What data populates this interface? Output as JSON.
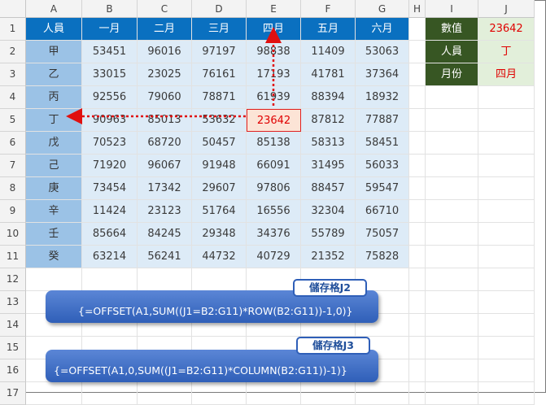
{
  "columns": [
    "A",
    "B",
    "C",
    "D",
    "E",
    "F",
    "G",
    "H",
    "I",
    "J"
  ],
  "rows": [
    "1",
    "2",
    "3",
    "4",
    "5",
    "6",
    "7",
    "8",
    "9",
    "10",
    "11",
    "12",
    "13",
    "14",
    "15",
    "16",
    "17"
  ],
  "table_header": [
    "人員",
    "一月",
    "二月",
    "三月",
    "四月",
    "五月",
    "六月"
  ],
  "table_rows": [
    {
      "name": "甲",
      "values": [
        "53451",
        "96016",
        "97197",
        "98838",
        "11409",
        "53063"
      ]
    },
    {
      "name": "乙",
      "values": [
        "33015",
        "23025",
        "76161",
        "17193",
        "41781",
        "37364"
      ]
    },
    {
      "name": "丙",
      "values": [
        "92556",
        "79060",
        "78871",
        "61939",
        "88394",
        "18932"
      ]
    },
    {
      "name": "丁",
      "values": [
        "90963",
        "85013",
        "53632",
        "23642",
        "87812",
        "77887"
      ]
    },
    {
      "name": "戊",
      "values": [
        "70523",
        "68720",
        "50457",
        "85138",
        "58313",
        "58451"
      ]
    },
    {
      "name": "己",
      "values": [
        "71920",
        "96067",
        "91948",
        "66091",
        "31495",
        "56033"
      ]
    },
    {
      "name": "庚",
      "values": [
        "73454",
        "17342",
        "29607",
        "97806",
        "88457",
        "59547"
      ]
    },
    {
      "name": "辛",
      "values": [
        "11424",
        "23123",
        "51764",
        "16556",
        "32304",
        "66710"
      ]
    },
    {
      "name": "壬",
      "values": [
        "85664",
        "84245",
        "29348",
        "34376",
        "55789",
        "75057"
      ]
    },
    {
      "name": "癸",
      "values": [
        "63214",
        "56241",
        "44732",
        "40729",
        "21352",
        "75828"
      ]
    }
  ],
  "lookup": [
    {
      "label": "數值",
      "value": "23642"
    },
    {
      "label": "人員",
      "value": "丁"
    },
    {
      "label": "月份",
      "value": "四月"
    }
  ],
  "callouts": [
    {
      "tag": "儲存格J2",
      "formula": "{=OFFSET(A1,SUM((J1=B2:G11)*ROW(B2:G11))-1,0)}"
    },
    {
      "tag": "儲存格J3",
      "formula": "{=OFFSET(A1,0,SUM((J1=B2:G11)*COLUMN(B2:G11))-1)}"
    }
  ],
  "colors": {
    "header_blue": "#0a70c0",
    "name_blue": "#9bc2e6",
    "data_blue": "#ddebf7",
    "label_green": "#375623",
    "value_green": "#e2efda",
    "highlight_red": "#e00000"
  }
}
